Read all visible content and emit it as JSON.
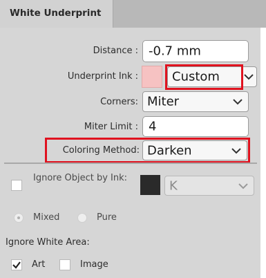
{
  "tab": {
    "title": "White Underprint"
  },
  "distance": {
    "label": "Distance :",
    "value": "-0.7 mm"
  },
  "underprint_ink": {
    "label": "Underprint Ink :",
    "value": "Custom",
    "swatch_color": "#f6c2c2"
  },
  "corners": {
    "label": "Corners:",
    "value": "Miter"
  },
  "miter_limit": {
    "label": "Miter Limit :",
    "value": "4"
  },
  "coloring_method": {
    "label": "Coloring Method:",
    "value": "Darken"
  },
  "ignore_object": {
    "label": "Ignore Object by Ink:",
    "ink_value": "K",
    "swatch_color": "#2a2a2a"
  },
  "mode": {
    "options": [
      "Mixed",
      "Pure"
    ]
  },
  "ignore_white": {
    "label": "Ignore White Area:",
    "art_label": "Art",
    "art_checked": true,
    "image_label": "Image",
    "image_checked": false
  },
  "colors": {
    "highlight": "#e0121f",
    "panel_bg": "#d6d6d6"
  }
}
